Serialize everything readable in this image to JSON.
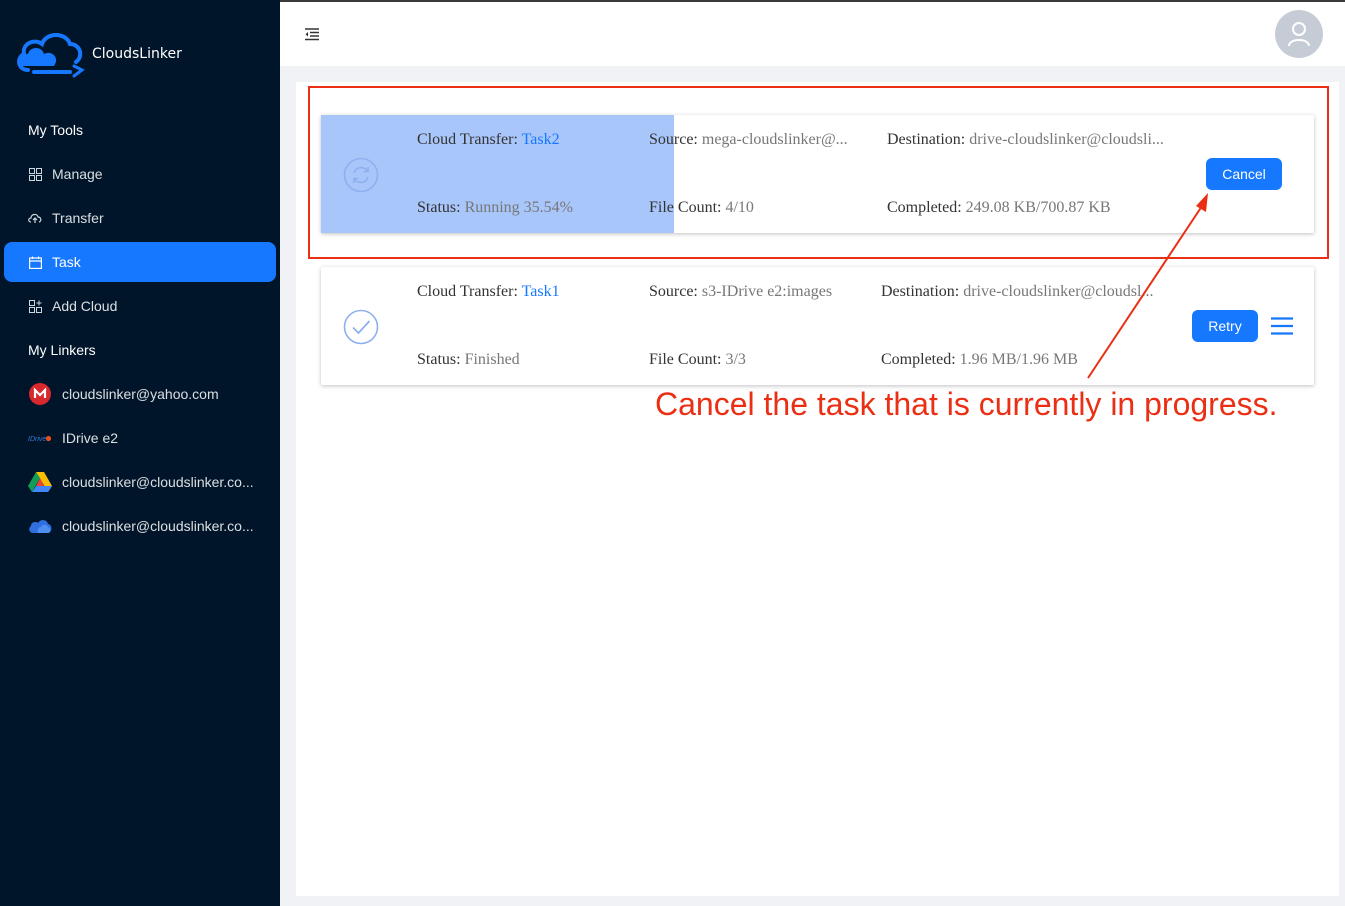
{
  "app": {
    "name": "CloudsLinker"
  },
  "sidebar": {
    "tools_title": "My Tools",
    "tools": [
      {
        "label": "Manage",
        "icon": "grid-icon"
      },
      {
        "label": "Transfer",
        "icon": "cloud-sync-icon"
      },
      {
        "label": "Task",
        "icon": "calendar-icon",
        "active": true
      },
      {
        "label": "Add Cloud",
        "icon": "add-cloud-icon"
      }
    ],
    "linkers_title": "My Linkers",
    "linkers": [
      {
        "label": "cloudslinker@yahoo.com",
        "icon": "mega-icon"
      },
      {
        "label": "IDrive e2",
        "icon": "idrive-icon",
        "icon_text": "IDrive"
      },
      {
        "label": "cloudslinker@cloudslinker.co...",
        "icon": "google-drive-icon"
      },
      {
        "label": "cloudslinker@cloudslinker.co...",
        "icon": "onedrive-icon"
      }
    ]
  },
  "header": {
    "collapse_icon": "menu-fold-icon",
    "avatar_icon": "user-icon"
  },
  "tasks": [
    {
      "type_label": "Cloud Transfer: ",
      "name": "Task2",
      "source_label": "Source: ",
      "source": "mega-cloudslinker@...",
      "destination_label": "Destination: ",
      "destination": "drive-cloudslinker@cloudsli...",
      "status_label": "Status: ",
      "status": "Running 35.54%",
      "progress": 0.3554,
      "file_count_label": "File Count: ",
      "file_count": "4/10",
      "completed_label": "Completed: ",
      "completed": "249.08 KB/700.87 KB",
      "action": "Cancel",
      "icon": "sync-icon"
    },
    {
      "type_label": "Cloud Transfer: ",
      "name": "Task1",
      "source_label": "Source: ",
      "source": "s3-IDrive e2:images",
      "destination_label": "Destination: ",
      "destination": "drive-cloudslinker@cloudsl...",
      "status_label": "Status: ",
      "status": "Finished",
      "file_count_label": "File Count: ",
      "file_count": "3/3",
      "completed_label": "Completed: ",
      "completed": "1.96 MB/1.96 MB",
      "action": "Retry",
      "icon": "check-circle-icon",
      "menu_icon": "more-menu-icon"
    }
  ],
  "annotation": {
    "text": "Cancel the task that is currently in progress.",
    "color": "#ea2f14"
  },
  "colors": {
    "sidebar_bg": "#001529",
    "primary": "#1677ff",
    "progress": "#a9c6fb"
  }
}
